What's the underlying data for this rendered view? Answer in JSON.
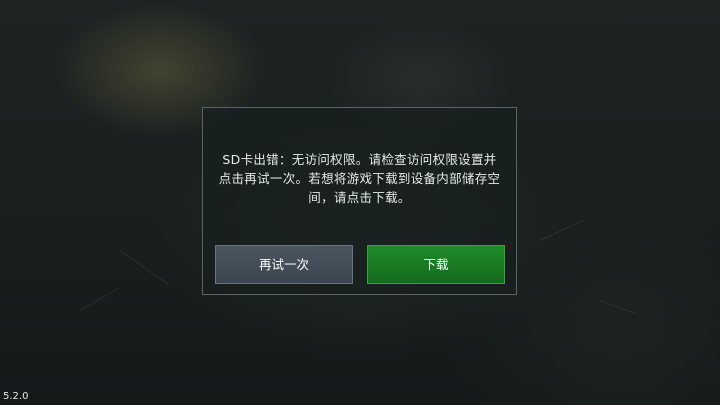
{
  "dialog": {
    "message": "SD卡出错：无访问权限。请检查访问权限设置并点击再试一次。若想将游戏下载到设备内部储存空间，请点击下载。",
    "retry_label": "再试一次",
    "download_label": "下载"
  },
  "version": "5.2.0",
  "colors": {
    "dialog_border": "#5a6468",
    "retry_button": "#434d58",
    "download_button": "#1a7c24"
  }
}
